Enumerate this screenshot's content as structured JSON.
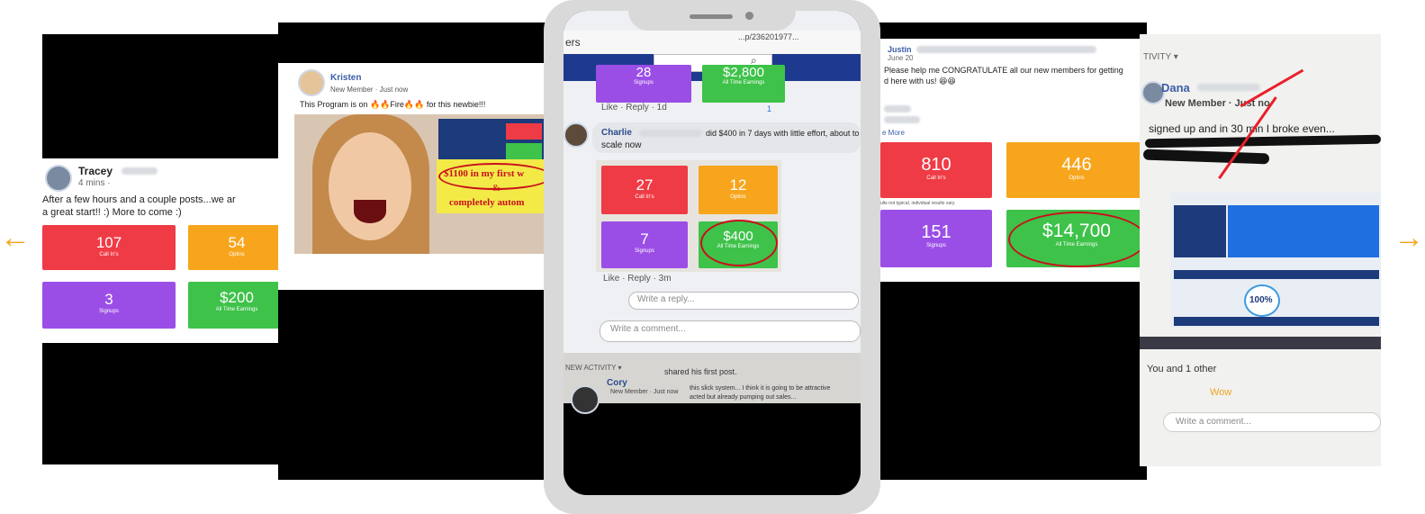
{
  "carousel": {
    "prev_arrow": "←",
    "next_arrow": "→"
  },
  "card1": {
    "name": "Tracey",
    "time": "4 mins ·",
    "post": "After a few hours and a couple posts...we ar",
    "post2": "a great start!! :)  More to come :)",
    "tiles": [
      {
        "value": "107",
        "label": "Call In's"
      },
      {
        "value": "54",
        "label": "Optins"
      },
      {
        "value": "3",
        "label": "Signups"
      },
      {
        "value": "$200",
        "label": "All Time Earnings"
      }
    ]
  },
  "card2": {
    "name": "Kristen",
    "meta": "New Member · Just now",
    "post": "This Program is on 🔥🔥Fire🔥🔥 for this newbie!!!",
    "sign1": "$1100 in my first w",
    "sign2": "&",
    "sign3": "completely autom"
  },
  "phone": {
    "url_text": "ers",
    "url_tail": "...p/236201977...",
    "top_tiles": [
      {
        "value": "28",
        "label": "Signups"
      },
      {
        "value": "$2,800",
        "label": "All Time Earnings"
      }
    ],
    "like1": "Like · Reply · 1d",
    "reaction_count": "1",
    "comment_name": "Charlie",
    "comment_text": "did $400 in 7 days with little effort, about to",
    "comment_text2": "scale now",
    "tiles": [
      {
        "value": "27",
        "label": "Call In's"
      },
      {
        "value": "12",
        "label": "Optins"
      },
      {
        "value": "7",
        "label": "Signups"
      },
      {
        "value": "$400",
        "label": "All Time Earnings"
      }
    ],
    "like2": "Like · Reply · 3m",
    "reply_placeholder": "Write a reply...",
    "comment_placeholder": "Write a comment...",
    "activity": "NEW ACTIVITY ▾",
    "activity_text": "shared his first post.",
    "cory_name": "Cory",
    "cory_meta": "New Member · Just now",
    "cory_text": "this slick system... I think it is going to be attractive",
    "cory_text2": "acted but already pumping out sales..."
  },
  "card4": {
    "name": "Justin",
    "date": "June 20",
    "post": "Please help me CONGRATULATE all our new members for getting",
    "post2": "d here with us! 😆😆",
    "more": "e More",
    "disclaimer": "ults not typical, individual results vary.",
    "tiles": [
      {
        "value": "810",
        "label": "Call In's"
      },
      {
        "value": "446",
        "label": "Optins"
      },
      {
        "value": "151",
        "label": "Signups"
      },
      {
        "value": "$14,700",
        "label": "All Time Earnings"
      }
    ]
  },
  "card5": {
    "activity": "TIVITY ▾",
    "name": "Dana",
    "meta": "New Member · Just no",
    "post": "signed up and in 30 min I broke even...",
    "percent": "100%",
    "reactions": "You and 1 other",
    "wow": "Wow",
    "comment_placeholder": "Write a comment..."
  }
}
